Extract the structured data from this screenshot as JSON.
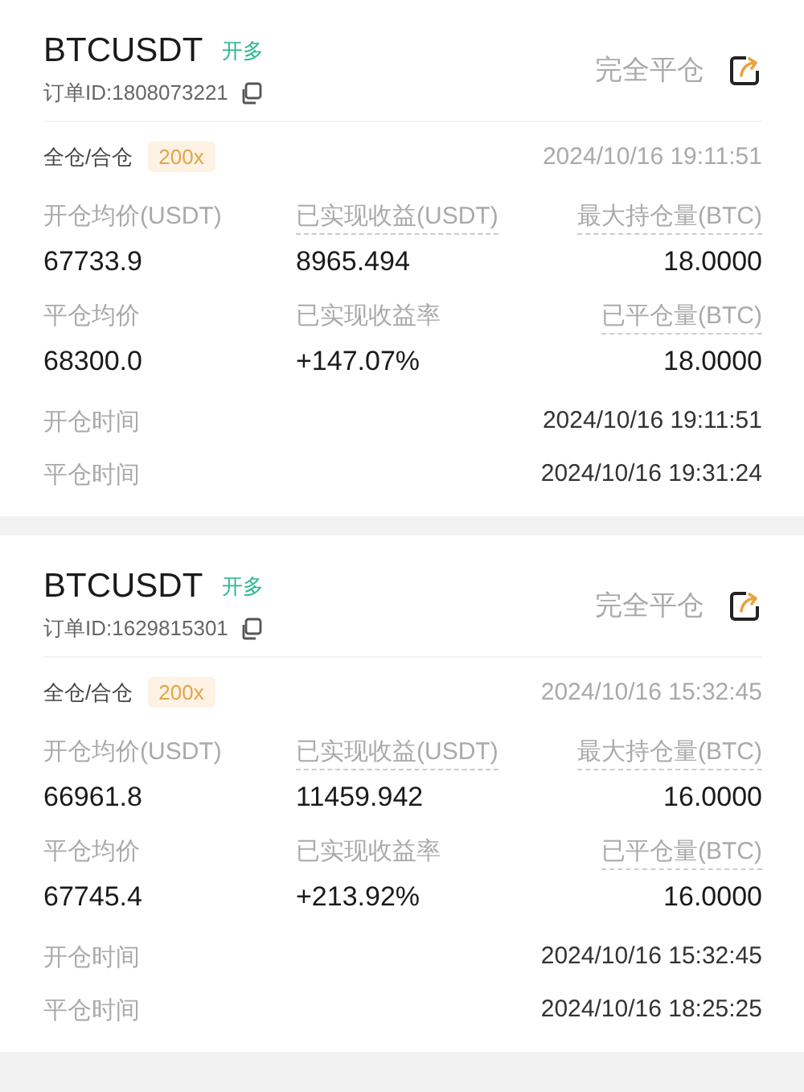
{
  "orders": [
    {
      "symbol": "BTCUSDT",
      "side": "开多",
      "order_id": "订单ID:1808073221",
      "action": "完全平仓",
      "margin_mode": "全仓/合仓",
      "leverage": "200x",
      "opened": "2024/10/16 19:11:51",
      "stats": [
        {
          "label": "开仓均价(USDT)",
          "value": "67733.9",
          "underlined": false
        },
        {
          "label": "已实现收益(USDT)",
          "value": "8965.494",
          "underlined": true
        },
        {
          "label": "最大持仓量(BTC)",
          "value": "18.0000",
          "underlined": true
        },
        {
          "label": "平仓均价",
          "value": "68300.0",
          "underlined": false
        },
        {
          "label": "已实现收益率",
          "value": "+147.07%",
          "underlined": false
        },
        {
          "label": "已平仓量(BTC)",
          "value": "18.0000",
          "underlined": true
        }
      ],
      "times": [
        {
          "label": "开仓时间",
          "value": "2024/10/16 19:11:51"
        },
        {
          "label": "平仓时间",
          "value": "2024/10/16 19:31:24"
        }
      ]
    },
    {
      "symbol": "BTCUSDT",
      "side": "开多",
      "order_id": "订单ID:1629815301",
      "action": "完全平仓",
      "margin_mode": "全仓/合仓",
      "leverage": "200x",
      "opened": "2024/10/16 15:32:45",
      "stats": [
        {
          "label": "开仓均价(USDT)",
          "value": "66961.8",
          "underlined": false
        },
        {
          "label": "已实现收益(USDT)",
          "value": "11459.942",
          "underlined": true
        },
        {
          "label": "最大持仓量(BTC)",
          "value": "16.0000",
          "underlined": true
        },
        {
          "label": "平仓均价",
          "value": "67745.4",
          "underlined": false
        },
        {
          "label": "已实现收益率",
          "value": "+213.92%",
          "underlined": false
        },
        {
          "label": "已平仓量(BTC)",
          "value": "16.0000",
          "underlined": true
        }
      ],
      "times": [
        {
          "label": "开仓时间",
          "value": "2024/10/16 15:32:45"
        },
        {
          "label": "平仓时间",
          "value": "2024/10/16 18:25:25"
        }
      ]
    }
  ]
}
